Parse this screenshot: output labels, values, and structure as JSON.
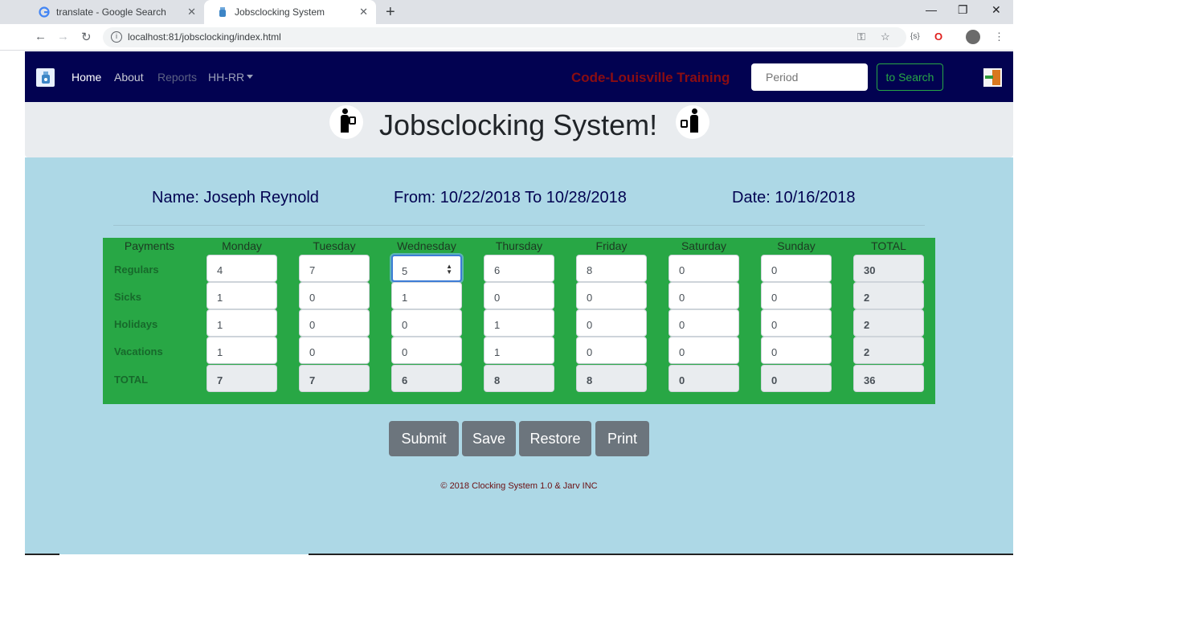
{
  "browser": {
    "tabs": [
      {
        "title": "translate - Google Search",
        "active": false
      },
      {
        "title": "Jobsclocking System",
        "active": true
      }
    ],
    "url": "localhost:81/jobsclocking/index.html"
  },
  "navbar": {
    "links": [
      "Home",
      "About",
      "Reports",
      "HH-RR"
    ],
    "training": "Code-Louisville Training",
    "search_placeholder": "Period",
    "search_button": "to Search"
  },
  "jumbotron": {
    "title": "Jobsclocking System!"
  },
  "info": {
    "name": "Name: Joseph Reynold",
    "range": "From: 10/22/2018 To 10/28/2018",
    "date": "Date: 10/16/2018"
  },
  "timesheet": {
    "headers": [
      "Payments",
      "Monday",
      "Tuesday",
      "Wednesday",
      "Thursday",
      "Friday",
      "Saturday",
      "Sunday",
      "TOTAL"
    ],
    "rows": [
      {
        "label": "Regulars",
        "values": [
          "4",
          "7",
          "5",
          "6",
          "8",
          "0",
          "0"
        ],
        "total": "30"
      },
      {
        "label": "Sicks",
        "values": [
          "1",
          "0",
          "1",
          "0",
          "0",
          "0",
          "0"
        ],
        "total": "2"
      },
      {
        "label": "Holidays",
        "values": [
          "1",
          "0",
          "0",
          "1",
          "0",
          "0",
          "0"
        ],
        "total": "2"
      },
      {
        "label": "Vacations",
        "values": [
          "1",
          "0",
          "0",
          "1",
          "0",
          "0",
          "0"
        ],
        "total": "2"
      }
    ],
    "total_row": {
      "label": "TOTAL",
      "values": [
        "7",
        "7",
        "6",
        "8",
        "8",
        "0",
        "0"
      ],
      "total": "36"
    }
  },
  "buttons": [
    "Submit",
    "Save",
    "Restore",
    "Print"
  ],
  "footer": "© 2018 Clocking System 1.0 & Jarv INC",
  "colors": {
    "navbar": "#020251",
    "main_bg": "#add8e6",
    "grid_bg": "#28a745",
    "training_text": "#8b0d12",
    "button": "#6c757d"
  }
}
